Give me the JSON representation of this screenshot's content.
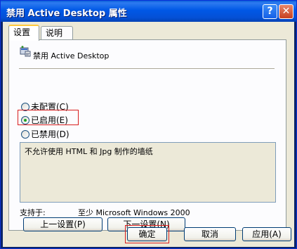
{
  "window": {
    "title": "禁用 Active Desktop 属性",
    "help_label": "?",
    "close_label": "✕"
  },
  "tabs": [
    {
      "label": "设置",
      "active": true
    },
    {
      "label": "说明",
      "active": false
    }
  ],
  "policy": {
    "icon": "policy-setting-icon",
    "name": "禁用 Active Desktop"
  },
  "options": [
    {
      "label": "未配置(C)",
      "selected": false
    },
    {
      "label": "已启用(E)",
      "selected": true
    },
    {
      "label": "已禁用(D)",
      "selected": false
    }
  ],
  "description": "不允许使用 HTML 和 Jpg 制作的墙纸",
  "support": {
    "label": "支持于:",
    "value": "至少 Microsoft Windows 2000"
  },
  "nav_buttons": {
    "prev": "上一设置(P)",
    "next": "下一设置(N)"
  },
  "dialog_buttons": {
    "ok": "确定",
    "cancel": "取消",
    "apply": "应用(A)"
  },
  "colors": {
    "titlebar": "#0058e6",
    "highlight_box": "#d81e1e",
    "dialog_bg": "#ece9d8"
  }
}
